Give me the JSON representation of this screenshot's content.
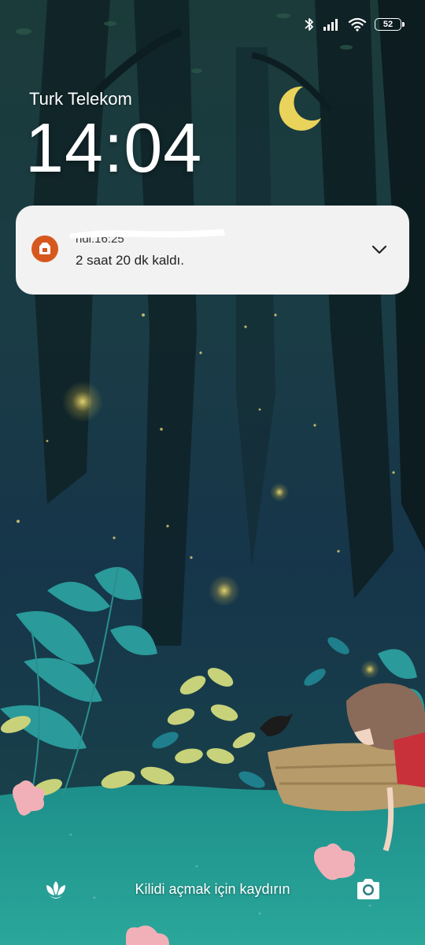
{
  "status_bar": {
    "icons": [
      "bluetooth-icon",
      "signal-icon",
      "wifi-icon",
      "battery-icon"
    ],
    "battery_level": "52"
  },
  "lockscreen": {
    "carrier": "Turk Telekom",
    "time": "14:04"
  },
  "notification": {
    "app_icon": "app-icon",
    "title_visible": "ndi:16:25",
    "body": "2 saat 20 dk kaldı.",
    "accent_color": "#d6581f"
  },
  "bottom": {
    "left_icon": "flower-icon",
    "hint": "Kilidi açmak için kaydırın",
    "right_icon": "camera-icon"
  }
}
